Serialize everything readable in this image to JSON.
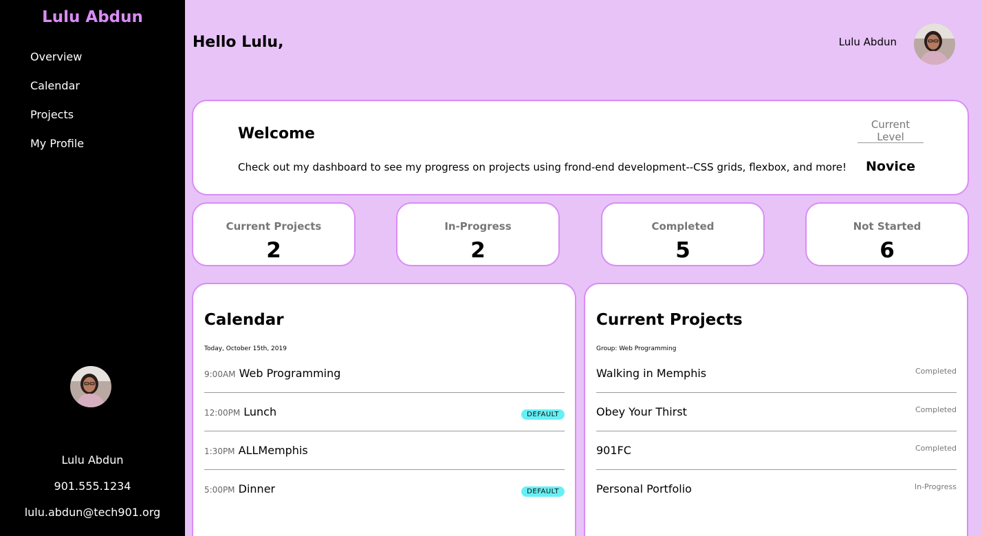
{
  "sidebar": {
    "brand": "Lulu Abdun",
    "nav": [
      {
        "label": "Overview"
      },
      {
        "label": "Calendar"
      },
      {
        "label": "Projects"
      },
      {
        "label": "My Profile"
      }
    ],
    "name": "Lulu Abdun",
    "phone": "901.555.1234",
    "email": "lulu.abdun@tech901.org"
  },
  "header": {
    "greeting": "Hello Lulu,",
    "username": "Lulu Abdun"
  },
  "welcome": {
    "title": "Welcome",
    "text": "Check out my dashboard to see my progress on projects using frond-end development--CSS grids, flexbox, and more!",
    "level_label": "Current Level",
    "level_value": "Novice"
  },
  "stats": [
    {
      "label": "Current Projects",
      "value": "2"
    },
    {
      "label": "In-Progress",
      "value": "2"
    },
    {
      "label": "Completed",
      "value": "5"
    },
    {
      "label": "Not Started",
      "value": "6"
    }
  ],
  "calendar": {
    "title": "Calendar",
    "date": "Today, October 15th, 2019",
    "events": [
      {
        "time": "9:00AM",
        "name": "Web Programming",
        "badge": ""
      },
      {
        "time": "12:00PM",
        "name": "Lunch",
        "badge": "DEFAULT"
      },
      {
        "time": "1:30PM",
        "name": "ALLMemphis",
        "badge": ""
      },
      {
        "time": "5:00PM",
        "name": "Dinner",
        "badge": "DEFAULT"
      }
    ]
  },
  "projects": {
    "title": "Current Projects",
    "group": "Group: Web Programming",
    "items": [
      {
        "name": "Walking in Memphis",
        "status": "Completed"
      },
      {
        "name": "Obey Your Thirst",
        "status": "Completed"
      },
      {
        "name": "901FC",
        "status": "Completed"
      },
      {
        "name": "Personal Portfolio",
        "status": "In-Progress"
      }
    ]
  },
  "colors": {
    "background": "#e8c3f7",
    "accent": "#d98cf5",
    "sidebar": "#000000",
    "badge": "#66f0f5"
  }
}
